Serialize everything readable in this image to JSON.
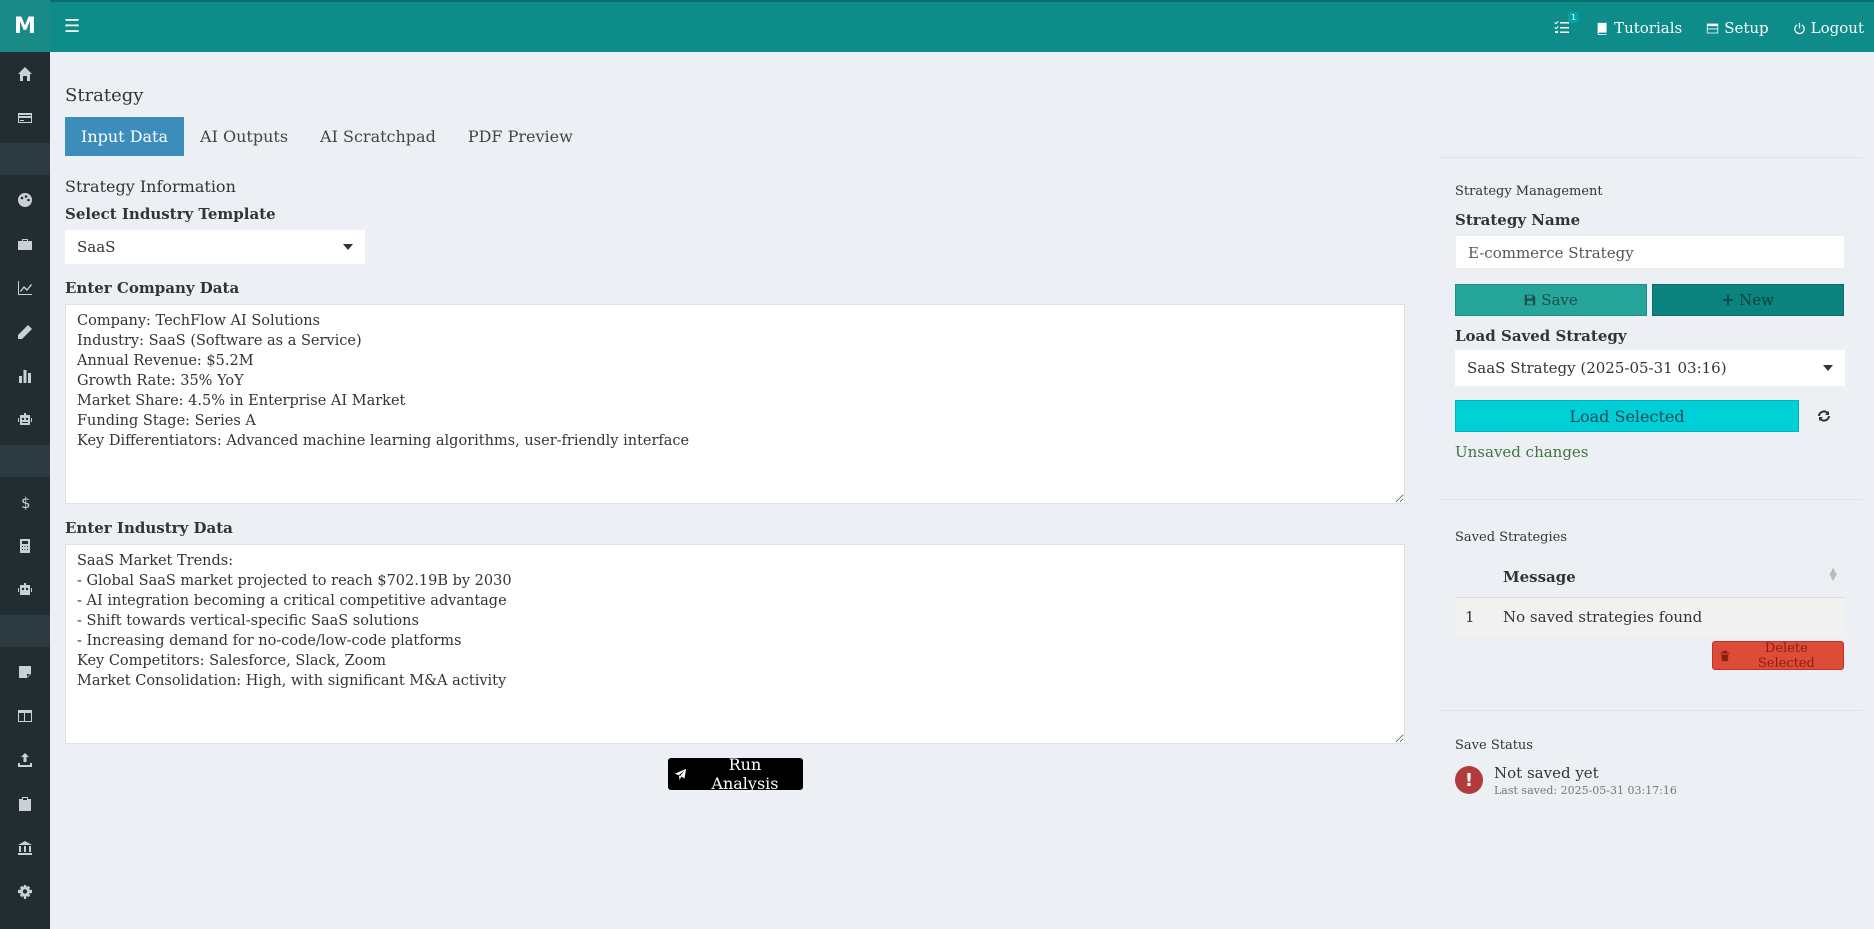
{
  "app": {
    "logo": "M"
  },
  "topbar": {
    "tasks_badge": "1",
    "tutorials": "Tutorials",
    "setup": "Setup",
    "logout": "Logout"
  },
  "sidebar": {
    "icons": [
      "home-icon",
      "credit-card-icon",
      "palette-icon",
      "briefcase-icon",
      "line-chart-icon",
      "pencil-icon",
      "bar-chart-icon",
      "robot-icon",
      "dollar-icon",
      "calculator-icon",
      "robot-icon",
      "note-icon",
      "table-icon",
      "upload-icon",
      "clipboard-icon",
      "bank-icon",
      "gear-icon"
    ]
  },
  "page": {
    "title": "Strategy",
    "tabs": [
      "Input Data",
      "AI Outputs",
      "AI Scratchpad",
      "PDF Preview"
    ],
    "active_tab": "Input Data"
  },
  "input": {
    "section_title": "Strategy Information",
    "template_label": "Select Industry Template",
    "template_value": "SaaS",
    "company_label": "Enter Company Data",
    "company_text": "Company: TechFlow AI Solutions\nIndustry: SaaS (Software as a Service)\nAnnual Revenue: $5.2M\nGrowth Rate: 35% YoY\nMarket Share: 4.5% in Enterprise AI Market\nFunding Stage: Series A\nKey Differentiators: Advanced machine learning algorithms, user-friendly interface",
    "industry_label": "Enter Industry Data",
    "industry_text": "SaaS Market Trends:\n- Global SaaS market projected to reach $702.19B by 2030\n- AI integration becoming a critical competitive advantage\n- Shift towards vertical-specific SaaS solutions\n- Increasing demand for no-code/low-code platforms\nKey Competitors: Salesforce, Slack, Zoom\nMarket Consolidation: High, with significant M&A activity",
    "run_button": "Run Analysis"
  },
  "management": {
    "title": "Strategy Management",
    "name_label": "Strategy Name",
    "name_value": "E-commerce Strategy",
    "save_button": "Save",
    "new_button": "New",
    "load_label": "Load Saved Strategy",
    "load_value": "SaaS Strategy (2025-05-31 03:16)",
    "load_button": "Load Selected",
    "unsaved": "Unsaved changes"
  },
  "saved": {
    "title": "Saved Strategies",
    "columns": [
      "",
      "Message"
    ],
    "rows": [
      [
        "1",
        "No saved strategies found"
      ]
    ],
    "delete_button": "Delete Selected"
  },
  "save_status": {
    "title": "Save Status",
    "icon_glyph": "!",
    "main": "Not saved yet",
    "sub": "Last saved: 2025-05-31 03:17:16"
  },
  "colors": {
    "header": "#0d8c89",
    "sidebar": "#222d32",
    "active_tab": "#3c8dbc",
    "save": "#26a69a",
    "new": "#0b847f",
    "load": "#00cfd8",
    "delete": "#dd4b39",
    "status_error": "#b23b3b"
  }
}
